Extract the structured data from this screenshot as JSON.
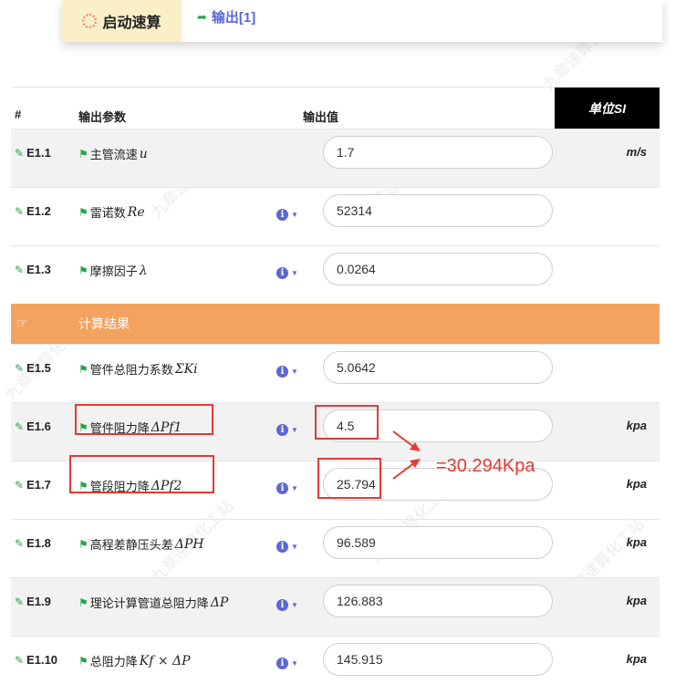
{
  "toolbar": {
    "start_label": "启动速算",
    "output_tab_label": "输出[1]"
  },
  "table": {
    "headers": {
      "num": "#",
      "param": "输出参数",
      "value": "输出值",
      "unit": "单位SI"
    },
    "rows": [
      {
        "id": "E1.1",
        "name": "主管流速",
        "symbol": "u",
        "value": "1.7",
        "unit": "m/s",
        "info": false,
        "gray": true
      },
      {
        "id": "E1.2",
        "name": "雷诺数",
        "symbol": "Re",
        "value": "52314",
        "unit": "",
        "info": true,
        "gray": false
      },
      {
        "id": "E1.3",
        "name": "摩擦因子",
        "symbol": "λ",
        "value": "0.0264",
        "unit": "",
        "info": true,
        "gray": false
      }
    ],
    "section_title": "计算结果",
    "rows2": [
      {
        "id": "E1.5",
        "name": "管件总阻力系数",
        "symbol": "ΣKi",
        "value": "5.0642",
        "unit": "",
        "info": true,
        "gray": false
      },
      {
        "id": "E1.6",
        "name": "管件阻力降",
        "symbol": "ΔPf1",
        "value": "4.5",
        "unit": "kpa",
        "info": true,
        "gray": true
      },
      {
        "id": "E1.7",
        "name": "管段阻力降",
        "symbol": "ΔPf2",
        "value": "25.794",
        "unit": "kpa",
        "info": true,
        "gray": false
      },
      {
        "id": "E1.8",
        "name": "高程差静压头差",
        "symbol": "ΔPH",
        "value": "96.589",
        "unit": "kpa",
        "info": true,
        "gray": false
      },
      {
        "id": "E1.9",
        "name": "理论计算管道总阻力降",
        "symbol": "ΔP",
        "value": "126.883",
        "unit": "kpa",
        "info": true,
        "gray": true
      },
      {
        "id": "E1.10",
        "name": "总阻力降",
        "symbol": "Kf × ΔP",
        "value": "145.915",
        "unit": "kpa",
        "info": true,
        "gray": false
      }
    ]
  },
  "annotation": {
    "text": "=30.294Kpa",
    "color": "#e53935"
  },
  "colors": {
    "accent": "#5a67d8",
    "section": "#f3a35f",
    "start_bg": "#fbefc8"
  }
}
